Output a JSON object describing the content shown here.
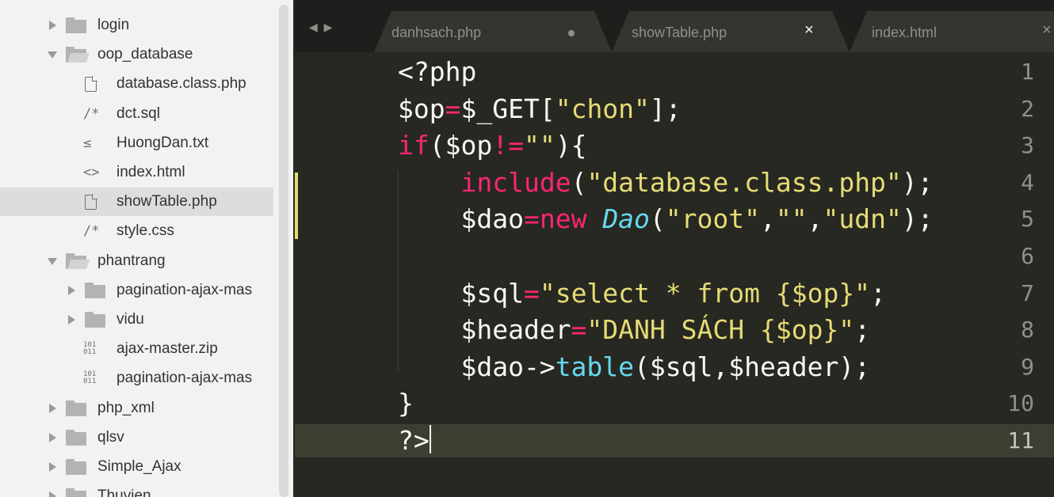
{
  "sidebar": {
    "items": [
      {
        "label": "login",
        "type": "folder",
        "state": "collapsed",
        "depth": 0
      },
      {
        "label": "oop_database",
        "type": "folder",
        "state": "expanded",
        "depth": 0
      },
      {
        "label": "database.class.php",
        "type": "file",
        "icon": "file-icon",
        "depth": 1
      },
      {
        "label": "dct.sql",
        "type": "file",
        "icon": "comment-icon",
        "glyph": "/*",
        "depth": 1
      },
      {
        "label": "HuongDan.txt",
        "type": "file",
        "icon": "text-file-icon",
        "glyph": "≤",
        "depth": 1
      },
      {
        "label": "index.html",
        "type": "file",
        "icon": "markup-icon",
        "glyph": "<>",
        "depth": 1
      },
      {
        "label": "showTable.php",
        "type": "file",
        "icon": "file-icon",
        "depth": 1,
        "selected": true
      },
      {
        "label": "style.css",
        "type": "file",
        "icon": "comment-icon",
        "glyph": "/*",
        "depth": 1
      },
      {
        "label": "phantrang",
        "type": "folder",
        "state": "expanded",
        "depth": 0
      },
      {
        "label": "pagination-ajax-mas",
        "type": "folder",
        "state": "collapsed",
        "depth": 1
      },
      {
        "label": "vidu",
        "type": "folder",
        "state": "collapsed",
        "depth": 1
      },
      {
        "label": "ajax-master.zip",
        "type": "file",
        "icon": "binary-icon",
        "glyph": "101\n011",
        "depth": 1
      },
      {
        "label": "pagination-ajax-mas",
        "type": "file",
        "icon": "binary-icon",
        "glyph": "101\n011",
        "depth": 1
      },
      {
        "label": "php_xml",
        "type": "folder",
        "state": "collapsed",
        "depth": 0
      },
      {
        "label": "qlsv",
        "type": "folder",
        "state": "collapsed",
        "depth": 0
      },
      {
        "label": "Simple_Ajax",
        "type": "folder",
        "state": "collapsed",
        "depth": 0
      },
      {
        "label": "Thuvien",
        "type": "folder",
        "state": "collapsed",
        "depth": 0
      }
    ]
  },
  "tabs": [
    {
      "label": "danhsach.php",
      "modified": true,
      "active": false
    },
    {
      "label": "showTable.php",
      "close": "×",
      "active": true
    },
    {
      "label": "index.html",
      "close": "×",
      "active": false
    }
  ],
  "nav": {
    "arrows": "◀ ▶"
  },
  "editor": {
    "active_line": 11,
    "lines": [
      {
        "n": "1",
        "text": "<?php"
      },
      {
        "n": "2",
        "text": "$op=$_GET[\"chon\"];"
      },
      {
        "n": "3",
        "text": "if($op!=\"\"){"
      },
      {
        "n": "4",
        "text": "    include(\"database.class.php\");"
      },
      {
        "n": "5",
        "text": "    $dao=new Dao(\"root\",\"\",\"udn\");"
      },
      {
        "n": "6",
        "text": ""
      },
      {
        "n": "7",
        "text": "    $sql=\"select * from {$op}\";"
      },
      {
        "n": "8",
        "text": "    $header=\"DANH SÁCH {$op}\";"
      },
      {
        "n": "9",
        "text": "    $dao->table($sql,$header);"
      },
      {
        "n": "10",
        "text": "}"
      },
      {
        "n": "11",
        "text": "?>"
      }
    ]
  },
  "colors": {
    "background": "#272822",
    "foreground": "#f8f8f2",
    "keyword": "#f92672",
    "string": "#e6db74",
    "function": "#66d9ef",
    "sidebar": "#f2f2f2",
    "modified_marker": "#e6db74"
  }
}
